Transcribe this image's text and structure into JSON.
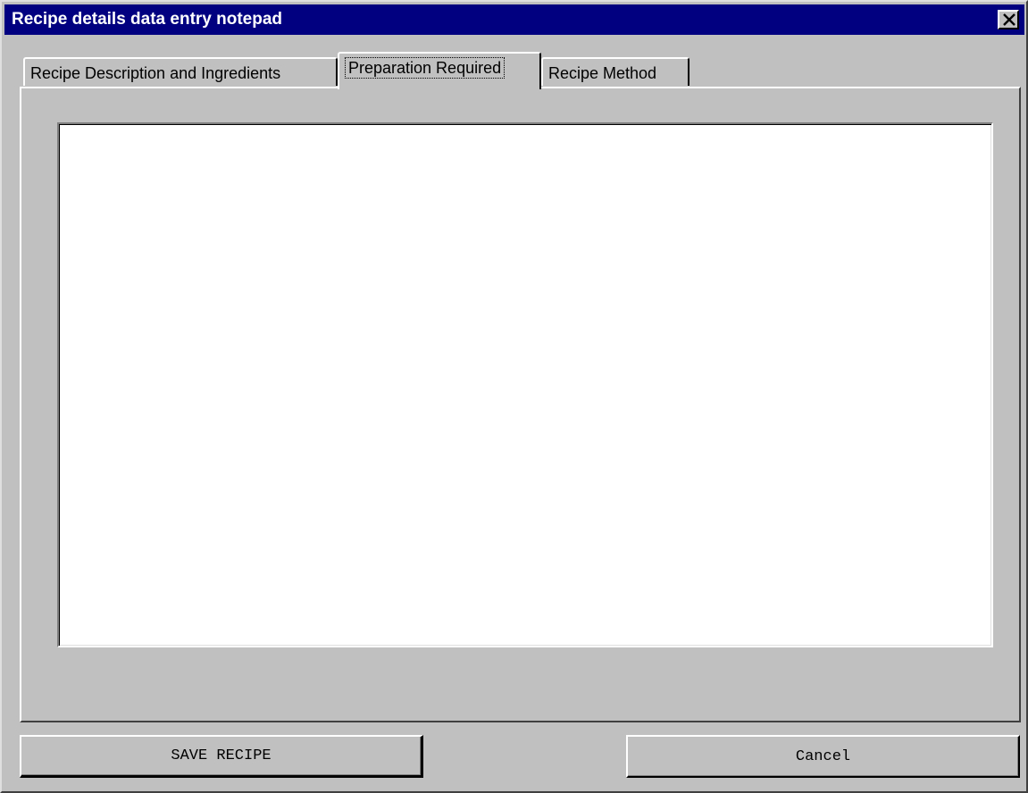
{
  "window": {
    "title": "Recipe details data entry notepad",
    "close_icon": "close-icon"
  },
  "tabs": [
    {
      "label": "Recipe Description and Ingredients",
      "active": false
    },
    {
      "label": "Preparation Required",
      "active": true
    },
    {
      "label": "Recipe Method",
      "active": false
    }
  ],
  "panel": {
    "preparation_text": ""
  },
  "buttons": {
    "save_label": "SAVE RECIPE",
    "cancel_label": "Cancel"
  },
  "colors": {
    "titlebar": "#000080",
    "face": "#c0c0c0",
    "field": "#ffffff"
  }
}
